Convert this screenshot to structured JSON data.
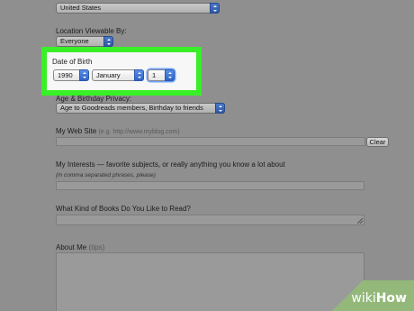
{
  "country": {
    "value": "United States"
  },
  "location_viewable": {
    "label": "Location Viewable By:",
    "value": "Everyone"
  },
  "dob": {
    "label": "Date of Birth",
    "year": "1990",
    "month": "January",
    "day": "1",
    "highlight_color": "#39ef27"
  },
  "privacy": {
    "label": "Age & Birthday Privacy:",
    "value": "Age to Goodreads members, Birthday to friends"
  },
  "website": {
    "label": "My Web Site",
    "hint": "(e.g. http://www.myblog.com)",
    "clear_label": "Clear"
  },
  "interests": {
    "label": "My Interests — favorite subjects, or really anything you know a lot about",
    "note": "(in comma separated phrases, please)"
  },
  "books": {
    "label": "What Kind of Books Do You Like to Read?"
  },
  "about": {
    "label": "About Me",
    "hint": "(tips)"
  },
  "watermark": {
    "wiki": "wiki",
    "how": "How"
  }
}
